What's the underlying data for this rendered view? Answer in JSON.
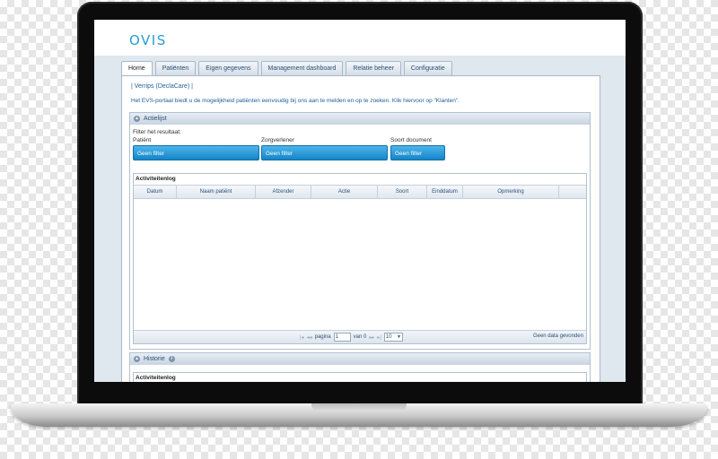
{
  "app": {
    "logo": "OVIS"
  },
  "tabs": [
    {
      "label": "Home",
      "active": true
    },
    {
      "label": "Patiënten",
      "active": false
    },
    {
      "label": "Eigen gegevens",
      "active": false
    },
    {
      "label": "Management dashboard",
      "active": false
    },
    {
      "label": "Relatie beheer",
      "active": false
    },
    {
      "label": "Configuratie",
      "active": false
    }
  ],
  "main": {
    "breadcrumb": "| Verrips (DeclaCare) |",
    "intro": "Het EVS-portaal biedt u de mogelijkheid patiënten eenvoudig bij ons aan te melden en op te zoeken. Klik hiervoor op \"Klanten\"."
  },
  "actielijst": {
    "title": "Actielijst",
    "filter_title": "Filter het resultaat:",
    "filters": [
      {
        "label": "Patiënt",
        "value": "Geen filter"
      },
      {
        "label": "Zorgverlener",
        "value": "Geen filter"
      },
      {
        "label": "Soort document",
        "value": "Geen filter"
      }
    ],
    "grid": {
      "title": "Activiteitenlog",
      "columns": [
        "Datum",
        "Naam patiënt",
        "Afzender",
        "Actie",
        "Soort",
        "Einddatum",
        "Opmerking"
      ],
      "pager": {
        "page_label": "pagina",
        "page_value": "1",
        "of_label": "van 0",
        "page_size": "10"
      },
      "empty_message": "Geen data gevonden"
    }
  },
  "historie": {
    "title": "Historie",
    "grid_title": "Activiteitenlog"
  },
  "colors": {
    "accent": "#2a9bd3",
    "filter_button": "#1f90d4",
    "panel_bg": "#dfe7ef"
  }
}
